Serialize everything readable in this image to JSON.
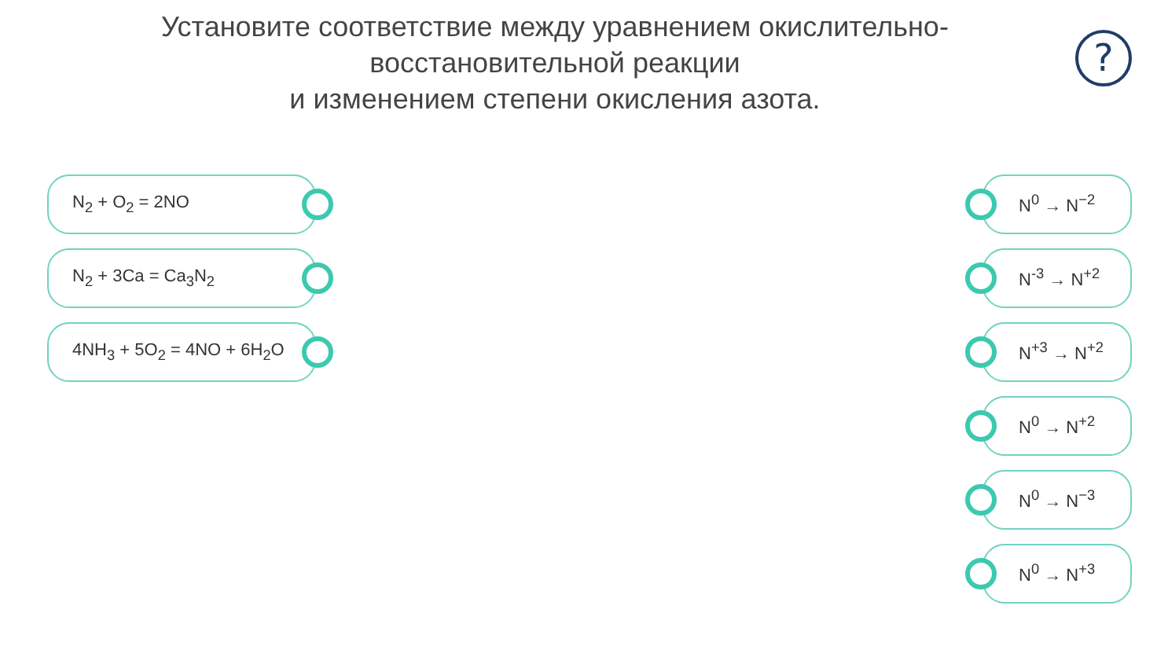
{
  "question": {
    "lines": [
      "Установите соответствие между уравнением окислительно-",
      "восстановительной реакции",
      "и изменением степени окисления азота."
    ]
  },
  "help_button": {
    "label": "?"
  },
  "left_items": [
    {
      "text": "N$_{2}$ + O$_{2}$ = 2NO"
    },
    {
      "text": "N$_{2}$ + 3Ca = Ca$_{3}$N$_{2}$"
    },
    {
      "text": "4NH$_{3}$ + 5O$_{2}$ = 4NO + 6H$_{2}$O"
    }
  ],
  "right_items": [
    {
      "text": "N$^{0}$ → N$^{−2}$"
    },
    {
      "text": "N$^{-3}$ → N$^{+2}$"
    },
    {
      "text": "N$^{+3}$ → N$^{+2}$"
    },
    {
      "text": "N$^{0}$ → N$^{+2}$"
    },
    {
      "text": "N$^{0}$ → N$^{−3}$"
    },
    {
      "text": "N$^{0}$ → N$^{+3}$"
    }
  ]
}
